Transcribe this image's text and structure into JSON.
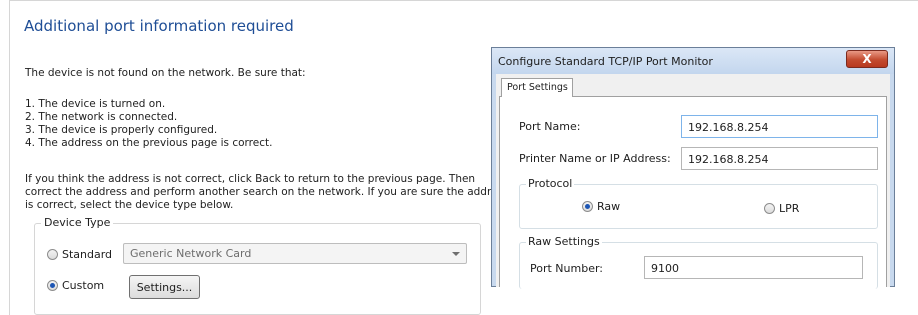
{
  "wizard": {
    "title": "Additional port information required",
    "intro": "The device is not found on the network.  Be sure that:",
    "checklist": [
      "1.  The device is turned on.",
      "2.  The network is connected.",
      "3.  The device is properly configured.",
      "4.  The address on the previous page is correct."
    ],
    "advice_lines": [
      "If you think the address is not correct, click Back to return to the previous page.  Then",
      "correct the address and perform another search on the network.  If you are sure the address",
      "is correct, select the device type below."
    ],
    "device_type": {
      "legend": "Device Type",
      "standard_label": "Standard",
      "standard_selected": false,
      "standard_value": "Generic Network Card",
      "custom_label": "Custom",
      "custom_selected": true,
      "settings_button": "Settings..."
    }
  },
  "dialog": {
    "title": "Configure Standard TCP/IP Port Monitor",
    "close_label": "X",
    "tab_label": "Port Settings",
    "port_name_label": "Port Name:",
    "port_name_value": "192.168.8.254",
    "printer_address_label": "Printer Name or IP Address:",
    "printer_address_value": "192.168.8.254",
    "protocol": {
      "legend": "Protocol",
      "raw_label": "Raw",
      "raw_selected": true,
      "lpr_label": "LPR",
      "lpr_selected": false
    },
    "raw_settings": {
      "legend": "Raw Settings",
      "port_number_label": "Port Number:",
      "port_number_value": "9100"
    }
  },
  "colors": {
    "title_blue": "#1f4e96",
    "dialog_frame": "#c8d9ee",
    "close_red": "#c34b2f"
  }
}
